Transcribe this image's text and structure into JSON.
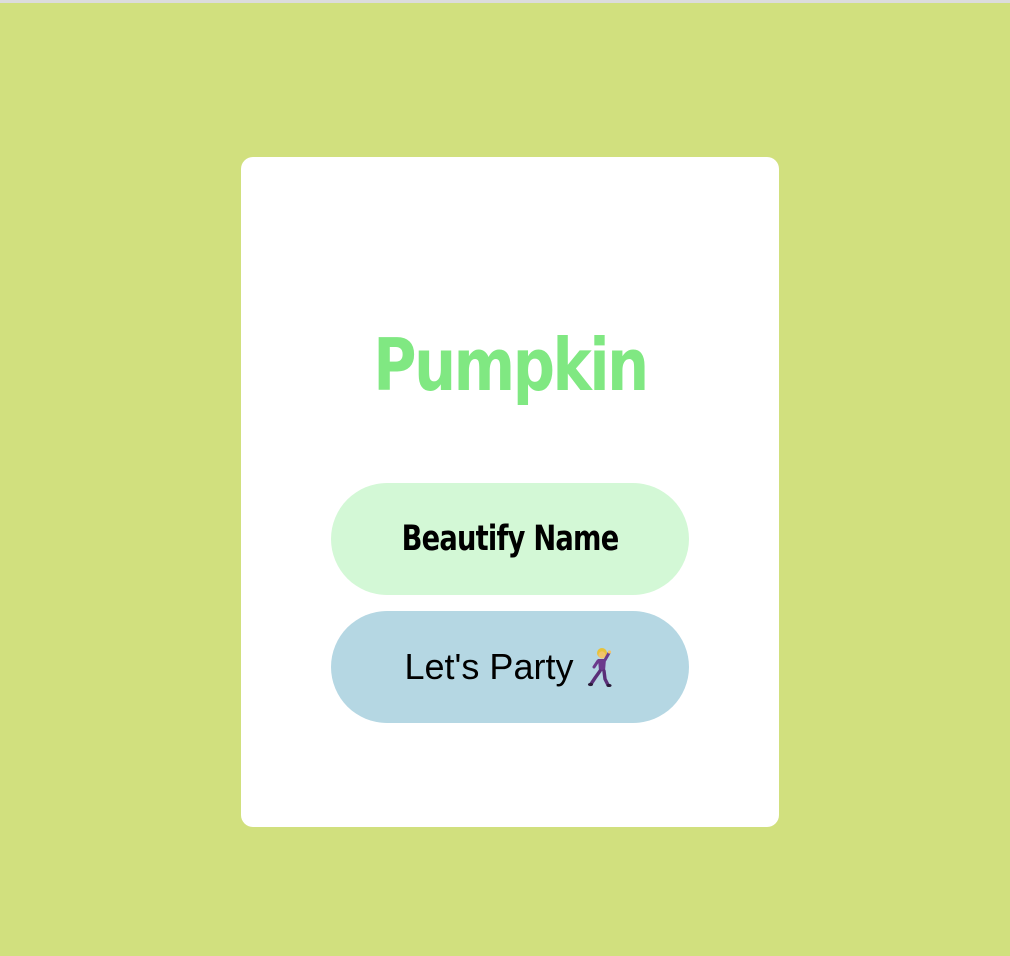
{
  "page": {
    "background_color": "#d1e07e",
    "card_color": "#ffffff"
  },
  "card": {
    "title": "Pumpkin",
    "title_color": "#80e882",
    "buttons": {
      "beautify": {
        "label": "Beautify Name",
        "color": "#d3f8d6"
      },
      "party": {
        "label": "Let's Party",
        "icon": "man-dancing-icon",
        "color": "#b5d7e3"
      }
    }
  }
}
